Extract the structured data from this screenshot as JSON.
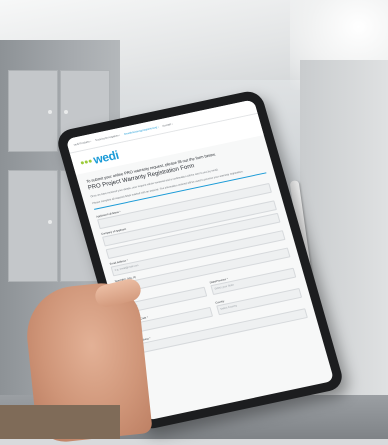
{
  "nav": {
    "items": [
      {
        "label": "wedi Produkte ›"
      },
      {
        "label": "Technische Angaben ›"
      },
      {
        "label": "Gewährleistungsregistrierung ›",
        "active": true
      },
      {
        "label": "Kontakt ›"
      }
    ]
  },
  "logo": {
    "text": "wedi"
  },
  "form": {
    "intro": "To submit your online PRO warranty request, please fill out the form below.",
    "title": "PRO Project Warranty Registration Form",
    "paragraph1": "Once we have received your details, your request will be reviewed and a confirmation will be sent to you by email.",
    "paragraph2": "Please complete all required fields marked with an asterisk. The information entered will be used to process your warranty registration.",
    "fields": {
      "applicant_label": "Applicant Full Name *",
      "company_label": "Company of Applicant",
      "email_label": "Email Address *",
      "email_placeholder": "e.g. email@mail.com",
      "specialist_label": "Specialist, (city, st)",
      "city_label": "City *",
      "city_placeholder": "City Name",
      "state_label": "State/Province *",
      "state_placeholder": "Select your State",
      "zip_label": "ZIP / Postal Code *",
      "country_label": "Country",
      "country_value": "Select Country",
      "street_label": "Street Address *"
    }
  },
  "colors": {
    "brand": "#1b9bd7",
    "accent_green": "#9ccb3b"
  }
}
